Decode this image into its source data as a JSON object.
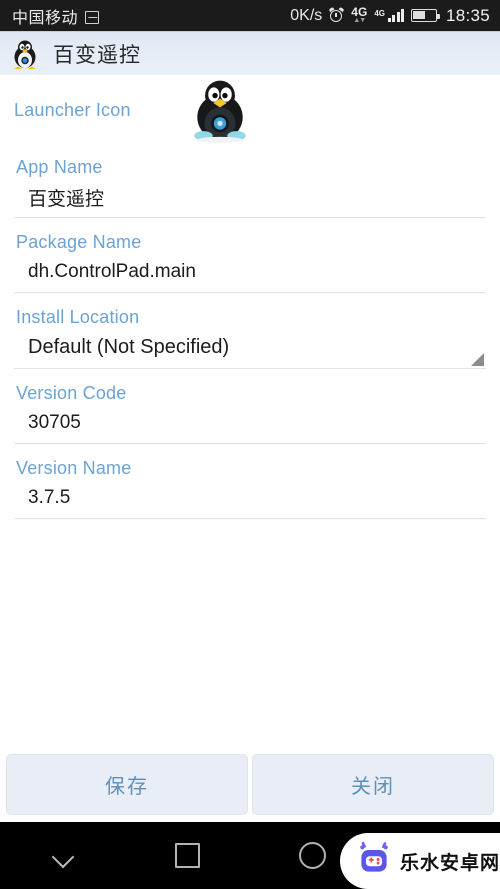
{
  "status_bar": {
    "carrier": "中国移动",
    "screenshot_icon": "screenshot-icon",
    "network_speed": "0K/s",
    "alarm_icon": "alarm-clock-icon",
    "network_type": "4G",
    "network_type_secondary": "4G",
    "signal_icon": "signal-bars-icon",
    "battery_icon": "battery-icon",
    "time": "18:35"
  },
  "app_bar": {
    "icon": "tux-penguin-icon",
    "title": "百变遥控"
  },
  "form": {
    "launcher": {
      "label": "Launcher Icon",
      "icon": "tux-penguin-launcher-icon"
    },
    "fields": [
      {
        "label": "App Name",
        "value": "百变遥控",
        "type": "text"
      },
      {
        "label": "Package Name",
        "value": "dh.ControlPad.main",
        "type": "text"
      },
      {
        "label": "Install Location",
        "value": "Default (Not Specified)",
        "type": "spinner"
      },
      {
        "label": "Version Code",
        "value": "30705",
        "type": "text"
      },
      {
        "label": "Version Name",
        "value": "3.7.5",
        "type": "text"
      }
    ]
  },
  "buttons": {
    "save": "保存",
    "close": "关闭"
  },
  "nav_bar": {
    "collapse": "chevron-down-icon",
    "recents": "square-recents-icon",
    "home": "circle-home-icon",
    "back": "triangle-back-icon"
  },
  "watermark": {
    "text": "乐水安卓网",
    "icon": "robot-mascot-icon"
  },
  "colors": {
    "label_blue": "#6ba3d6",
    "button_text": "#5d90bb",
    "button_fill": "#e9eef6",
    "appbar_bg": "#e6ecf6",
    "statusbar_bg": "#1b1b1b"
  }
}
